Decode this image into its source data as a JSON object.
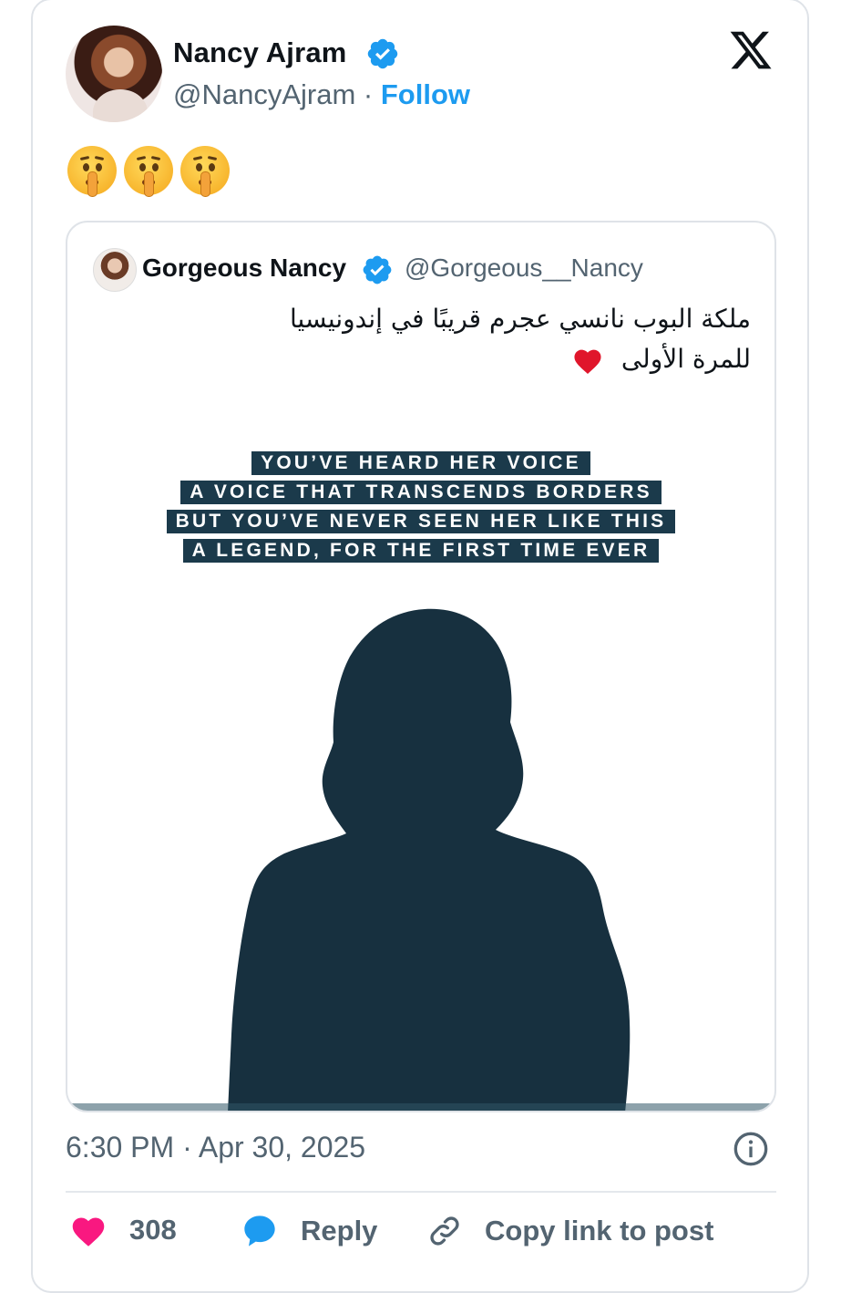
{
  "author": {
    "name": "Nancy Ajram",
    "handle": "@NancyAjram",
    "separator": "·",
    "follow_label": "Follow"
  },
  "tweet": {
    "emoji_count": 3
  },
  "quoted_tweet": {
    "name": "Gorgeous Nancy",
    "handle": "@Gorgeous__Nancy",
    "text_line1": "ملكة البوب نانسي عجرم قريبًا في إندونيسيا",
    "text_line2": "للمرة الأولى",
    "image_text": [
      "YOU’VE HEARD HER VOICE",
      "A VOICE THAT TRANSCENDS BORDERS",
      "BUT YOU’VE NEVER SEEN HER LIKE THIS",
      "A LEGEND, FOR THE FIRST TIME EVER"
    ]
  },
  "timestamp": "6:30 PM · Apr 30, 2025",
  "actions": {
    "like_count": "308",
    "reply_label": "Reply",
    "copy_label": "Copy link to post"
  },
  "colors": {
    "accent_blue": "#1d9bf0",
    "like_pink": "#f91880",
    "silhouette": "#17303f",
    "text_secondary": "#536471"
  },
  "icons": [
    "verified-badge-icon",
    "x-logo-icon",
    "shushing-face-emoji",
    "red-heart-icon",
    "info-icon",
    "heart-icon",
    "reply-bubble-icon",
    "link-icon"
  ]
}
